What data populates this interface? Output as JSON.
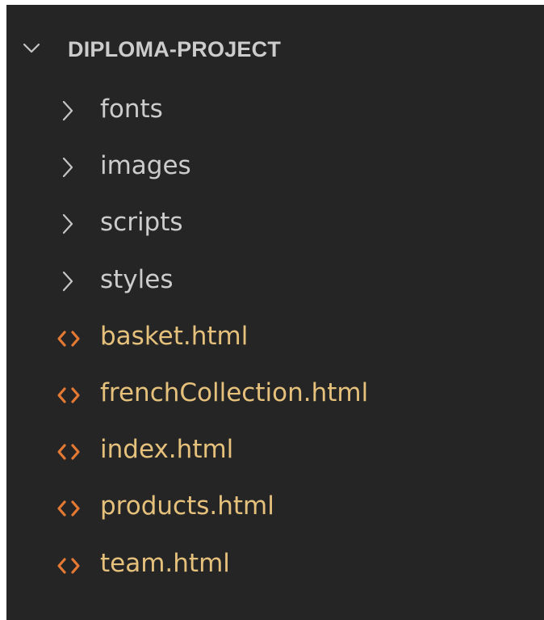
{
  "explorer": {
    "root": {
      "label": "DIPLOMA-PROJECT",
      "expanded": true,
      "icon": "chevron-down-icon"
    },
    "items": [
      {
        "type": "folder",
        "label": "fonts",
        "icon": "chevron-right-icon"
      },
      {
        "type": "folder",
        "label": "images",
        "icon": "chevron-right-icon"
      },
      {
        "type": "folder",
        "label": "scripts",
        "icon": "chevron-right-icon"
      },
      {
        "type": "folder",
        "label": "styles",
        "icon": "chevron-right-icon"
      },
      {
        "type": "file",
        "label": "basket.html",
        "icon": "html-file-icon"
      },
      {
        "type": "file",
        "label": "frenchCollection.html",
        "icon": "html-file-icon"
      },
      {
        "type": "file",
        "label": "index.html",
        "icon": "html-file-icon"
      },
      {
        "type": "file",
        "label": "products.html",
        "icon": "html-file-icon"
      },
      {
        "type": "file",
        "label": "team.html",
        "icon": "html-file-icon"
      }
    ]
  },
  "colors": {
    "background": "#252526",
    "folder_text": "#cccccc",
    "file_text": "#e5c17c",
    "html_icon": "#e37933",
    "chevron": "#c5c5c5"
  }
}
